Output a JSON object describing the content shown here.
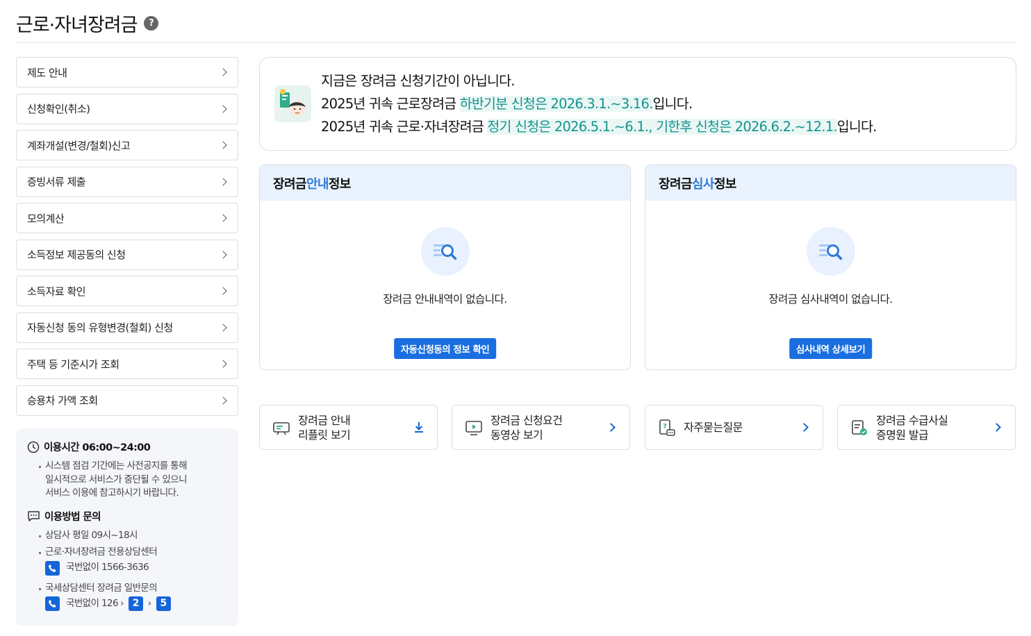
{
  "page": {
    "title": "근로·자녀장려금",
    "help_symbol": "?"
  },
  "sidebar": {
    "items": [
      {
        "label": "제도 안내"
      },
      {
        "label": "신청확인(취소)"
      },
      {
        "label": "계좌개설(변경/철회)신고"
      },
      {
        "label": "증빙서류 제출"
      },
      {
        "label": "모의계산"
      },
      {
        "label": "소득정보 제공동의 신청"
      },
      {
        "label": "소득자료 확인"
      },
      {
        "label": "자동신청 동의 유형변경(철회) 신청"
      },
      {
        "label": "주택 등 기준시가 조회"
      },
      {
        "label": "승용차 가액 조회"
      }
    ]
  },
  "service_info": {
    "hours_title": "이용시간 06:00~24:00",
    "hours_note_1": "시스템 점검 기간에는 사전공지를 통해",
    "hours_note_2": "일시적으로 서비스가 중단될 수 있으니",
    "hours_note_3": "서비스 이용에 참고하시기 바랍니다.",
    "inquiry_title": "이용방법 문의",
    "inquiry_item_1": "상담사 평일 09시~18시",
    "inquiry_item_2": "근로·자녀장려금 전용상담센터",
    "phone_1": "국번없이 1566-3636",
    "inquiry_item_3": "국세상담센터 장려금 일반문의",
    "phone_2": "국번없이 126",
    "menu_step_1": "2",
    "menu_step_2": "5"
  },
  "notice": {
    "line1": "지금은 장려금 신청기간이 아닙니다.",
    "line2_prefix": "2025년 귀속 근로장려금 ",
    "line2_highlight": "하반기분 신청은 2026.3.1.~3.16.",
    "line2_suffix": "입니다.",
    "line3_prefix": "2025년 귀속 근로·자녀장려금 ",
    "line3_highlight": "정기 신청은 2026.5.1.~6.1., 기한후 신청은 2026.6.2.~12.1.",
    "line3_suffix": "입니다."
  },
  "guide_card": {
    "title_prefix": "장려금 ",
    "title_accent": "안내",
    "title_suffix": " 정보",
    "empty_text": "장려금 안내내역이 없습니다.",
    "button": "자동신청동의 정보 확인"
  },
  "review_card": {
    "title_prefix": "장려금 ",
    "title_accent": "심사",
    "title_suffix": " 정보",
    "empty_text": "장려금 심사내역이 없습니다.",
    "button": "심사내역 상세보기"
  },
  "quick_links": [
    {
      "line1": "장려금 안내",
      "line2": "리플릿 보기",
      "icon": "leaflet-icon",
      "action": "download-icon"
    },
    {
      "line1": "장려금 신청요건",
      "line2": "동영상 보기",
      "icon": "video-icon",
      "action": "chevron-right-icon"
    },
    {
      "line1": "자주묻는질문",
      "line2": "",
      "icon": "faq-icon",
      "action": "chevron-right-icon"
    },
    {
      "line1": "장려금 수급사실",
      "line2": "증명원 발급",
      "icon": "certificate-icon",
      "action": "chevron-right-icon"
    }
  ],
  "colors": {
    "accent_blue": "#1a6ee0",
    "highlight_teal": "#13948c",
    "card_header_bg": "#eaf2fd"
  }
}
